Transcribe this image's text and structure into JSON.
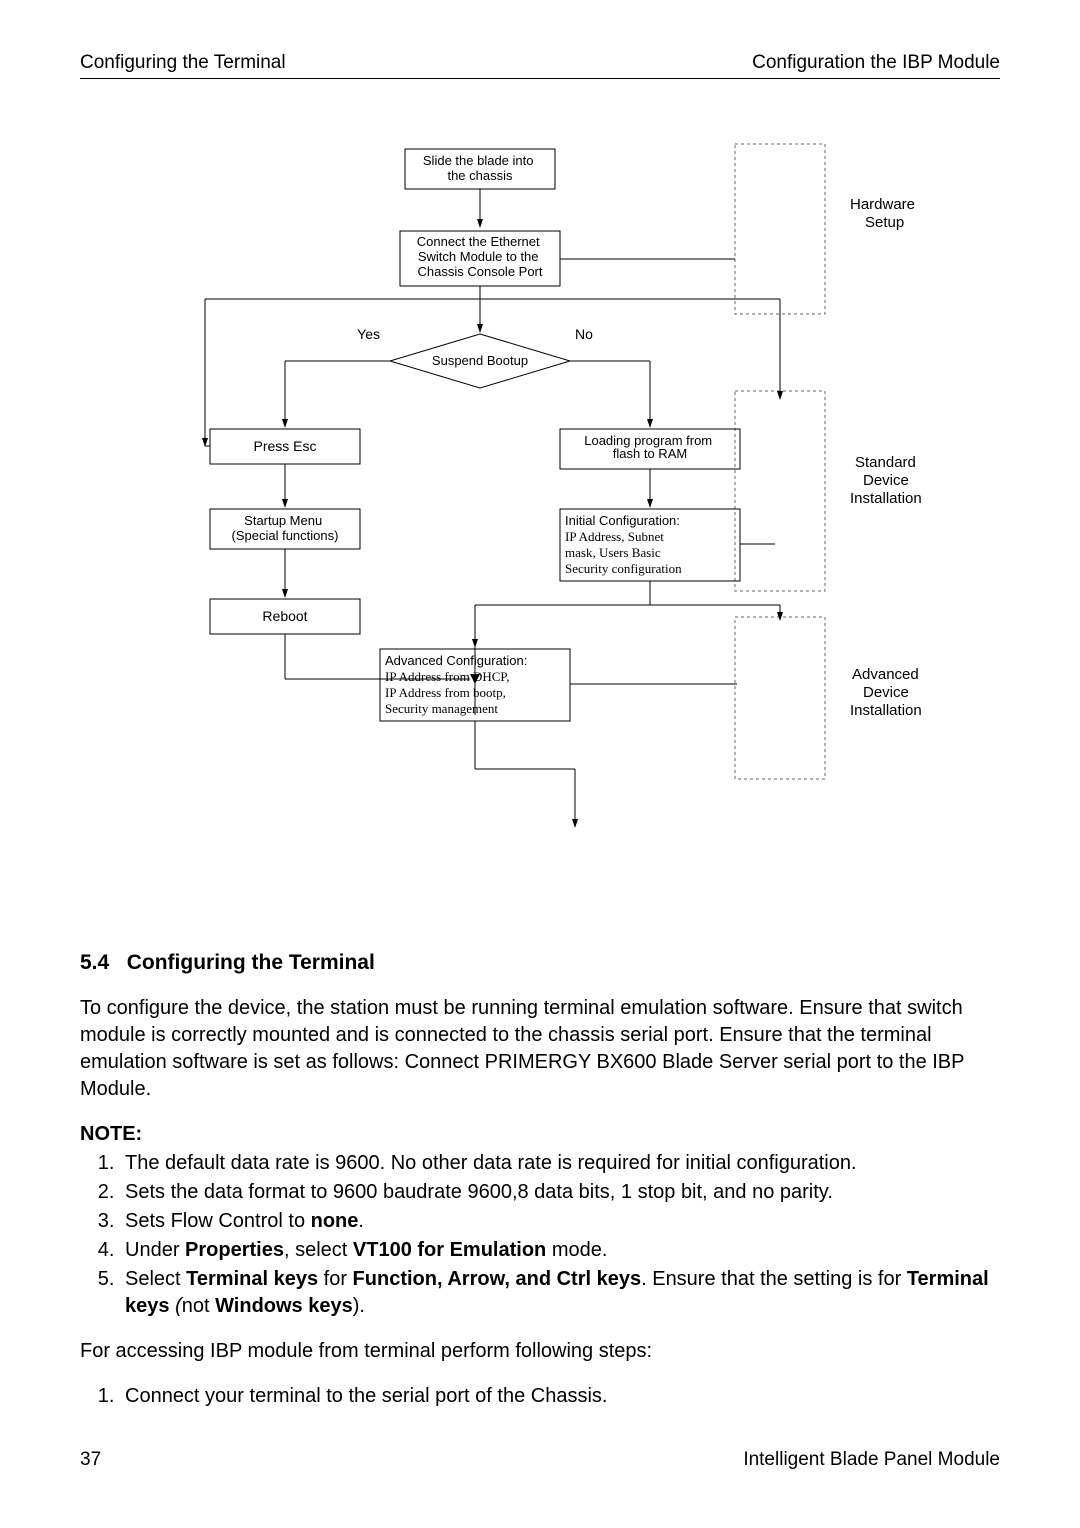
{
  "header": {
    "left": "Configuring the Terminal",
    "right": "Configuration the IBP Module"
  },
  "diagram": {
    "box_slide": {
      "l1": "Slide the blade into",
      "l2": "the chassis"
    },
    "box_connect": {
      "l1": "Connect the Ethernet",
      "l2": "Switch Module to the",
      "l3": "Chassis Console Port"
    },
    "decision": "Suspend Bootup",
    "yes": "Yes",
    "no": "No",
    "box_loading": {
      "l1": "Loading program from",
      "l2": "flash to RAM"
    },
    "box_pressesc": "Press Esc",
    "box_startup": {
      "l1": "Startup Menu",
      "l2": "(Special functions)"
    },
    "box_initial": {
      "l1": "Initial Configuration:",
      "l2": "IP Address, Subnet",
      "l3": "mask, Users Basic",
      "l4": "Security configuration"
    },
    "box_reboot": "Reboot",
    "box_advanced": {
      "l1": "Advanced Configuration:",
      "l2": "IP Address from DHCP,",
      "l3": "IP Address from bootp,",
      "l4": "Security management"
    },
    "label_hw": {
      "l1": "Hardware",
      "l2": "Setup"
    },
    "label_std": {
      "l1": "Standard",
      "l2": "Device",
      "l3": "Installation"
    },
    "label_adv": {
      "l1": "Advanced",
      "l2": "Device",
      "l3": "Installation"
    }
  },
  "section": {
    "number": "5.4",
    "title": "Configuring the Terminal"
  },
  "para_main": "To configure the device, the station must be running terminal emulation software. Ensure that switch module is correctly mounted and is connected to the chassis serial port. Ensure that the terminal emulation software is set as follows: Connect PRIMERGY BX600 Blade Server serial port to the IBP Module.",
  "note_label": "NOTE:",
  "notes": {
    "n1": "The default data rate is 9600. No other data rate is required for initial configuration.",
    "n2": "Sets the data format to 9600 baudrate 9600,8 data bits, 1 stop bit, and no parity.",
    "n3_a": "Sets Flow Control to ",
    "n3_b": "none",
    "n3_c": ".",
    "n4_a": "Under ",
    "n4_b": "Properties",
    "n4_c": ", select ",
    "n4_d": "VT100 for Emulation",
    "n4_e": " mode.",
    "n5_a": "Select ",
    "n5_b": "Terminal keys",
    "n5_c": " for ",
    "n5_d": "Function, Arrow, and Ctrl keys",
    "n5_e": ". Ensure that the setting is for ",
    "n5_f": "Terminal keys ",
    "n5_g": "(",
    "n5_h": "not ",
    "n5_i": "Windows keys",
    "n5_j": ")."
  },
  "para_access": "For accessing IBP module from terminal perform following steps:",
  "steps": {
    "s1": "Connect your terminal to the serial port of the Chassis."
  },
  "footer": {
    "page": "37",
    "title": "Intelligent Blade Panel Module"
  }
}
